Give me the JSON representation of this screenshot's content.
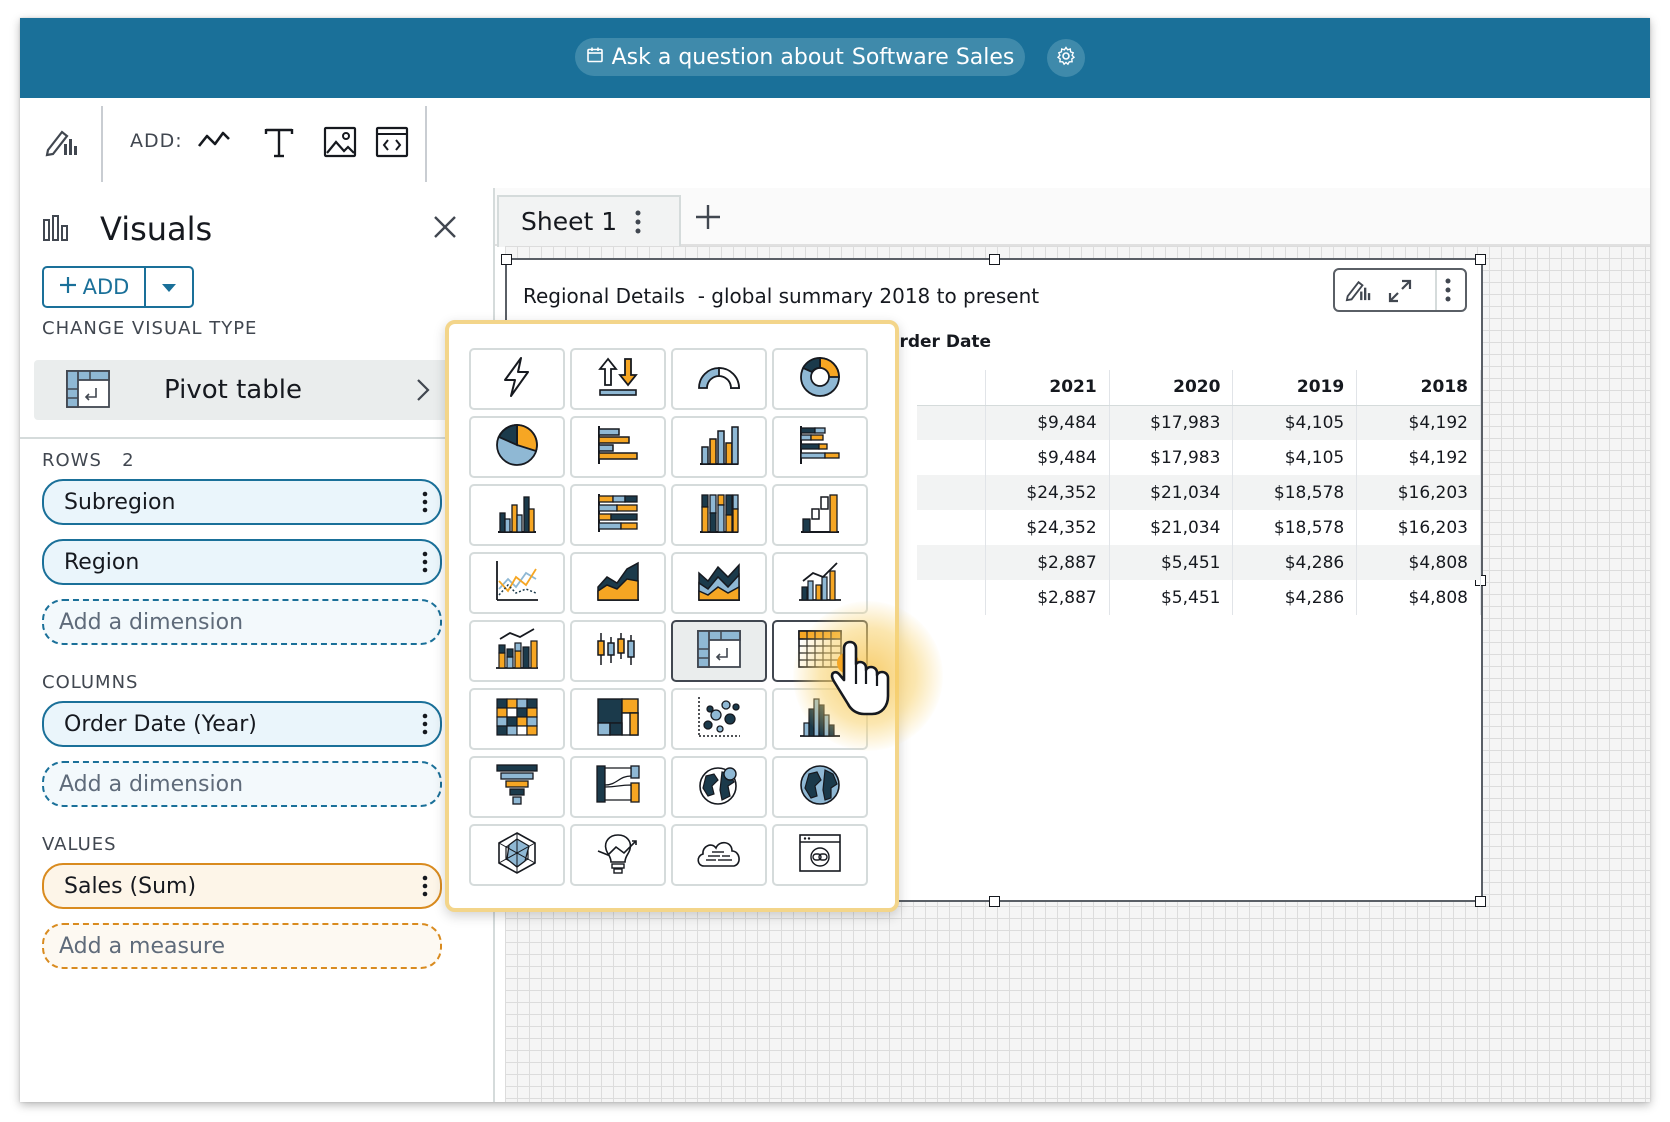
{
  "topbar": {
    "ask_prefix": "Ask a question about",
    "ask_dataset": "Software Sales"
  },
  "toolbar": {
    "add_label": "ADD:"
  },
  "left_panel": {
    "title": "Visuals",
    "add_button": "ADD",
    "change_visual_type_label": "CHANGE VISUAL TYPE",
    "visual_type": "Pivot table",
    "rows_label": "ROWS",
    "rows_count": "2",
    "rows": [
      "Subregion",
      "Region"
    ],
    "add_dimension": "Add a dimension",
    "columns_label": "COLUMNS",
    "columns": [
      "Order Date (Year)"
    ],
    "values_label": "VALUES",
    "values": [
      "Sales (Sum)"
    ],
    "add_measure": "Add a measure"
  },
  "sheet": {
    "tab_name": "Sheet 1"
  },
  "visual": {
    "title": "Regional Details",
    "subtitle": "- global summary 2018 to present",
    "column_group": "Order Date",
    "headers": [
      "2021",
      "2020",
      "2019",
      "2018"
    ],
    "rows": [
      [
        "$9,484",
        "$17,983",
        "$4,105",
        "$4,192"
      ],
      [
        "$9,484",
        "$17,983",
        "$4,105",
        "$4,192"
      ],
      [
        "$24,352",
        "$21,034",
        "$18,578",
        "$16,203"
      ],
      [
        "$24,352",
        "$21,034",
        "$18,578",
        "$16,203"
      ],
      [
        "$2,887",
        "$5,451",
        "$4,286",
        "$4,808"
      ],
      [
        "$2,887",
        "$5,451",
        "$4,286",
        "$4,808"
      ]
    ]
  },
  "visual_types": [
    "autograph-icon",
    "kpi-icon",
    "gauge-icon",
    "donut-icon",
    "pie-icon",
    "horizontal-bar-icon",
    "vertical-bar-icon",
    "clustered-horizontal-bar-icon",
    "clustered-vertical-bar-icon",
    "stacked-horizontal-bar-icon",
    "stacked-vertical-bar-icon",
    "waterfall-icon",
    "line-icon",
    "area-icon",
    "stacked-area-icon",
    "combo-bar-line-icon",
    "combo-stacked-line-icon",
    "box-plot-icon",
    "pivot-table-icon",
    "table-icon",
    "heat-map-icon",
    "tree-map-icon",
    "scatter-icon",
    "histogram-icon",
    "funnel-icon",
    "sankey-icon",
    "filled-map-icon",
    "points-map-icon",
    "radar-icon",
    "insight-icon",
    "word-cloud-icon",
    "custom-visual-icon"
  ],
  "colors": {
    "brand": "#1a7099",
    "accent_orange": "#f6a623",
    "dark_navy": "#1b3a4b",
    "light_blue": "#8fb8d4"
  }
}
